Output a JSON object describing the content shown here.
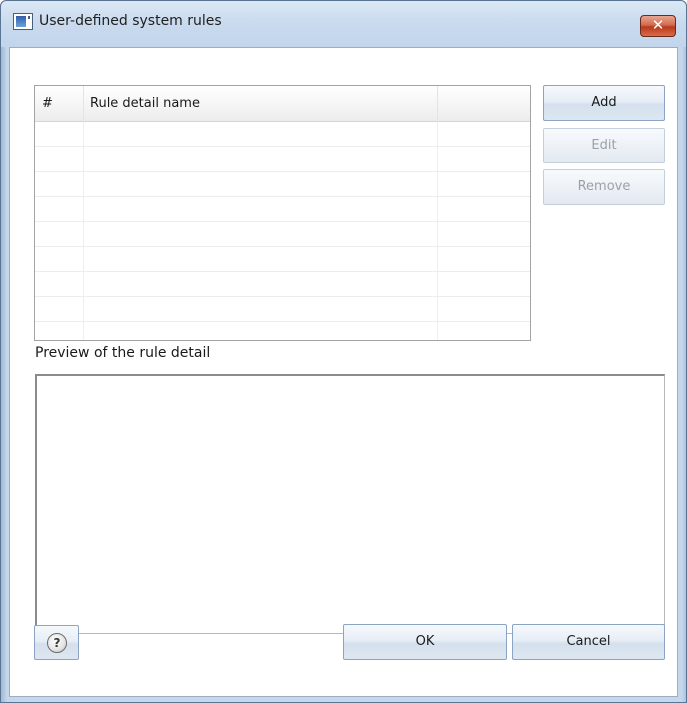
{
  "window": {
    "title": "User-defined system rules",
    "close_label": "✕"
  },
  "grid": {
    "columns": [
      "#",
      "Rule detail name",
      ""
    ],
    "rows": [
      [
        "",
        "",
        ""
      ],
      [
        "",
        "",
        ""
      ],
      [
        "",
        "",
        ""
      ],
      [
        "",
        "",
        ""
      ],
      [
        "",
        "",
        ""
      ],
      [
        "",
        "",
        ""
      ],
      [
        "",
        "",
        ""
      ],
      [
        "",
        "",
        ""
      ],
      [
        "",
        "",
        ""
      ]
    ]
  },
  "buttons": {
    "add": "Add",
    "edit": "Edit",
    "remove": "Remove",
    "ok": "OK",
    "cancel": "Cancel",
    "help": "?"
  },
  "preview": {
    "label": "Preview of the rule detail",
    "content": ""
  },
  "icons": {
    "app": "window-app-icon",
    "close": "close-icon",
    "help": "help-icon"
  },
  "colors": {
    "titlebar": "#c9daee",
    "close_button": "#c8472a",
    "button_border": "#8ba4c1",
    "disabled_text": "#9aa1a8"
  },
  "state": {
    "edit_enabled": false,
    "remove_enabled": false
  }
}
